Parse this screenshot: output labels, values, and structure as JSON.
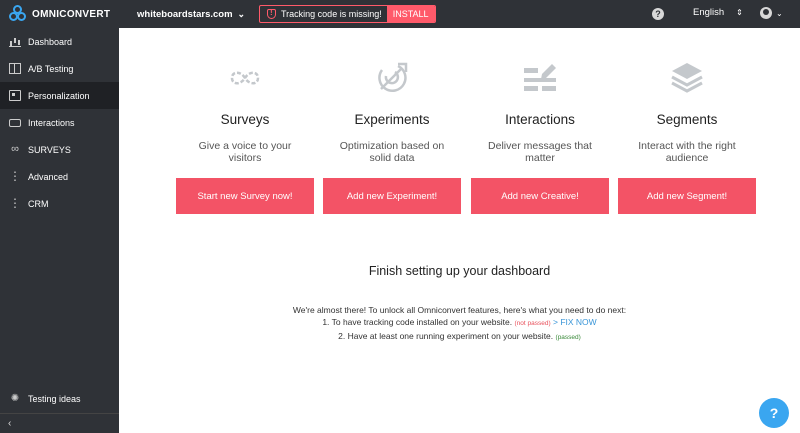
{
  "brand": {
    "name": "OMNICONVERT",
    "color": "#3aa6f0"
  },
  "header": {
    "site": "whiteboardstars.com",
    "alert_text": "Tracking code is missing!",
    "install_label": "INSTALL",
    "help_icon": "?",
    "language": "English"
  },
  "sidebar": {
    "items": [
      {
        "label": "Dashboard",
        "icon": "bar-chart-icon"
      },
      {
        "label": "A/B Testing",
        "icon": "split-icon"
      },
      {
        "label": "Personalization",
        "icon": "person-icon",
        "active": true
      },
      {
        "label": "Interactions",
        "icon": "chat-icon"
      },
      {
        "label": "SURVEYS",
        "icon": "infinity-icon"
      },
      {
        "label": "Advanced",
        "icon": "dots-icon"
      },
      {
        "label": "CRM",
        "icon": "dots-icon"
      }
    ],
    "bottom_item": {
      "label": "Testing ideas",
      "icon": "lightbulb-icon"
    },
    "collapse_glyph": "‹"
  },
  "cards": [
    {
      "title": "Surveys",
      "desc": "Give a voice to your visitors",
      "button": "Start new Survey now!",
      "icon": "infinity-icon"
    },
    {
      "title": "Experiments",
      "desc": "Optimization based on solid data",
      "button": "Add new Experiment!",
      "icon": "target-icon"
    },
    {
      "title": "Interactions",
      "desc": "Deliver messages that matter",
      "button": "Add new Creative!",
      "icon": "edit-layout-icon"
    },
    {
      "title": "Segments",
      "desc": "Interact with the right audience",
      "button": "Add new Segment!",
      "icon": "layers-icon"
    }
  ],
  "setup": {
    "title": "Finish setting up your dashboard",
    "intro": "We're almost there! To unlock all Omniconvert features, here's what you need to do next:",
    "step1": "1. To have tracking code installed on your website.",
    "step1_status": "(not passed)",
    "step1_link": "> FIX NOW",
    "step2": "2. Have at least one running experiment on your website.",
    "step2_status": "(passed)"
  },
  "colors": {
    "topbar": "#2f3237",
    "accent": "#f35366",
    "link": "#3a96d8"
  },
  "chat_icon": "?"
}
